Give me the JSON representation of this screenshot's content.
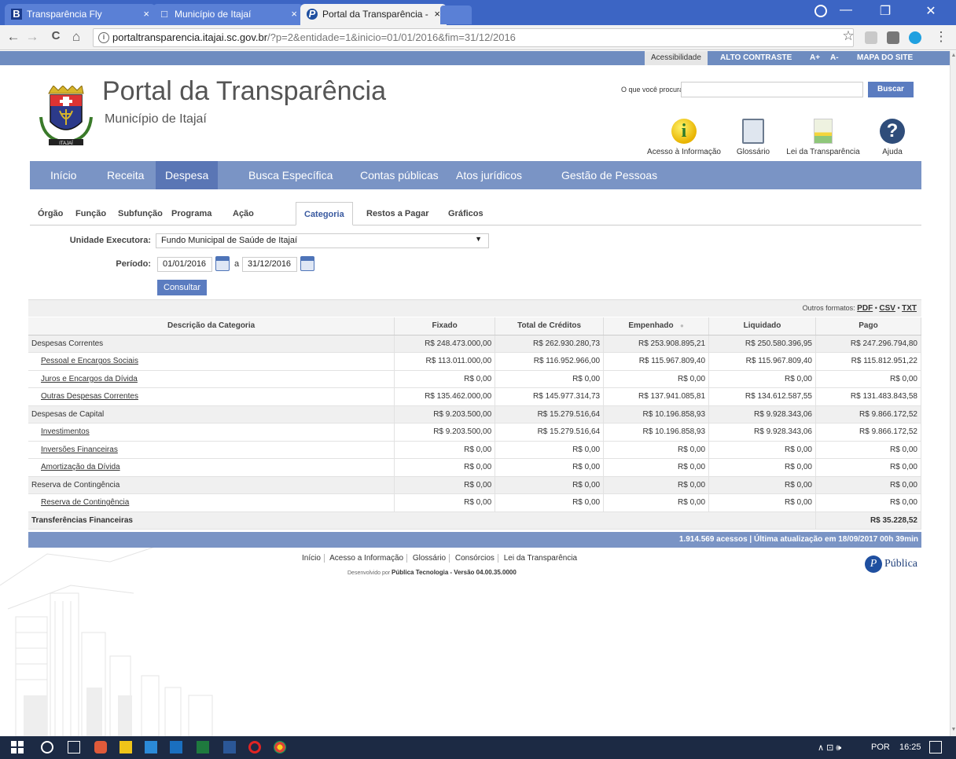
{
  "browser": {
    "tabs": [
      {
        "label": "Transparência Fly",
        "icon": "B"
      },
      {
        "label": "Município de Itajaí",
        "icon": "□"
      },
      {
        "label": "Portal da Transparência -",
        "icon": "P"
      }
    ],
    "close_glyph": "×",
    "window_controls": {
      "minimize": "—",
      "restore": "❐",
      "close": "✕"
    },
    "url_host": "portaltransparencia.itajai.sc.gov.br",
    "url_path": "/?p=2&entidade=1&inicio=01/01/2016&fim=31/12/2016",
    "nav": {
      "back": "←",
      "forward": "→",
      "reload": "C",
      "home": "⌂",
      "star": "☆",
      "menu": "⋮"
    }
  },
  "topstrip": {
    "accessibility": "Acessibilidade",
    "high_contrast": "ALTO CONTRASTE",
    "font_plus": "A+",
    "font_minus": "A-",
    "sitemap": "MAPA DO SITE"
  },
  "header": {
    "title": "Portal da Transparência",
    "subtitle": "Município de Itajaí",
    "search_label": "O que você procura?",
    "search_placeholder": "",
    "search_button": "Buscar",
    "quick_links": [
      "Acesso à Informação",
      "Glossário",
      "Lei da Transparência",
      "Ajuda"
    ],
    "info_glyph": "i",
    "help_glyph": "?"
  },
  "main_nav": [
    "Início",
    "Receita",
    "Despesa",
    "Busca Específica",
    "Contas públicas",
    "Atos jurídicos",
    "Gestão de Pessoas"
  ],
  "sub_nav": [
    "Órgão",
    "Função",
    "Subfunção",
    "Programa",
    "Ação",
    "Categoria",
    "Restos a Pagar",
    "Gráficos"
  ],
  "filters": {
    "unit_label": "Unidade Executora:",
    "unit_value": "Fundo Municipal de Saúde de Itajaí",
    "unit_arrow": "▼",
    "period_label": "Período:",
    "date_from": "01/01/2016",
    "date_sep": "a",
    "date_to": "31/12/2016",
    "submit": "Consultar"
  },
  "formats": {
    "label": "Outros formatos:",
    "pdf": "PDF",
    "csv": "CSV",
    "txt": "TXT",
    "bullet": "•"
  },
  "table": {
    "headers": [
      "Descrição da Categoria",
      "Fixado",
      "Total de Créditos",
      "Empenhado",
      "Liquidado",
      "Pago"
    ],
    "sort_glyph": "●",
    "rows": [
      {
        "kind": "cat",
        "desc": "Despesas Correntes",
        "vals": [
          "R$ 248.473.000,00",
          "R$ 262.930.280,73",
          "R$ 253.908.895,21",
          "R$ 250.580.396,95",
          "R$ 247.296.794,80"
        ]
      },
      {
        "kind": "sub",
        "desc": "Pessoal e Encargos Sociais",
        "vals": [
          "R$ 113.011.000,00",
          "R$ 116.952.966,00",
          "R$ 115.967.809,40",
          "R$ 115.967.809,40",
          "R$ 115.812.951,22"
        ]
      },
      {
        "kind": "sub",
        "desc": "Juros e Encargos da Dívida",
        "vals": [
          "R$ 0,00",
          "R$ 0,00",
          "R$ 0,00",
          "R$ 0,00",
          "R$ 0,00"
        ]
      },
      {
        "kind": "sub",
        "desc": "Outras Despesas Correntes",
        "vals": [
          "R$ 135.462.000,00",
          "R$ 145.977.314,73",
          "R$ 137.941.085,81",
          "R$ 134.612.587,55",
          "R$ 131.483.843,58"
        ]
      },
      {
        "kind": "cat",
        "desc": "Despesas de Capital",
        "vals": [
          "R$ 9.203.500,00",
          "R$ 15.279.516,64",
          "R$ 10.196.858,93",
          "R$ 9.928.343,06",
          "R$ 9.866.172,52"
        ]
      },
      {
        "kind": "sub",
        "desc": "Investimentos",
        "vals": [
          "R$ 9.203.500,00",
          "R$ 15.279.516,64",
          "R$ 10.196.858,93",
          "R$ 9.928.343,06",
          "R$ 9.866.172,52"
        ]
      },
      {
        "kind": "sub",
        "desc": "Inversões Financeiras",
        "vals": [
          "R$ 0,00",
          "R$ 0,00",
          "R$ 0,00",
          "R$ 0,00",
          "R$ 0,00"
        ]
      },
      {
        "kind": "sub",
        "desc": "Amortização da Dívida",
        "vals": [
          "R$ 0,00",
          "R$ 0,00",
          "R$ 0,00",
          "R$ 0,00",
          "R$ 0,00"
        ]
      },
      {
        "kind": "cat",
        "desc": "Reserva de Contingência",
        "vals": [
          "R$ 0,00",
          "R$ 0,00",
          "R$ 0,00",
          "R$ 0,00",
          "R$ 0,00"
        ]
      },
      {
        "kind": "sub",
        "desc": "Reserva de Contingência",
        "vals": [
          "R$ 0,00",
          "R$ 0,00",
          "R$ 0,00",
          "R$ 0,00",
          "R$ 0,00"
        ]
      }
    ],
    "transfer_label": "Transferências Financeiras",
    "transfer_value": "R$ 35.228,52"
  },
  "footer": {
    "stats": "1.914.569 acessos | Última atualização em 18/09/2017 00h 39min",
    "links": [
      "Início",
      "Acesso a Informação",
      "Glossário",
      "Consórcios",
      "Lei da Transparência"
    ],
    "dev_prefix": "Desenvolvido por",
    "dev_company": "Pública Tecnologia",
    "dev_version": "- Versão 04.00.35.0000",
    "brand": "Pública",
    "brand_mark": "P"
  },
  "taskbar": {
    "lang": "POR",
    "time": "16:25",
    "tray_glyphs": "∧ ⊡ 🕪"
  },
  "colors": {
    "nav_blue": "#7a94c5",
    "nav_active": "#5a76b5",
    "button_blue": "#5b7cc0",
    "chrome_blue": "#3c65c4"
  }
}
